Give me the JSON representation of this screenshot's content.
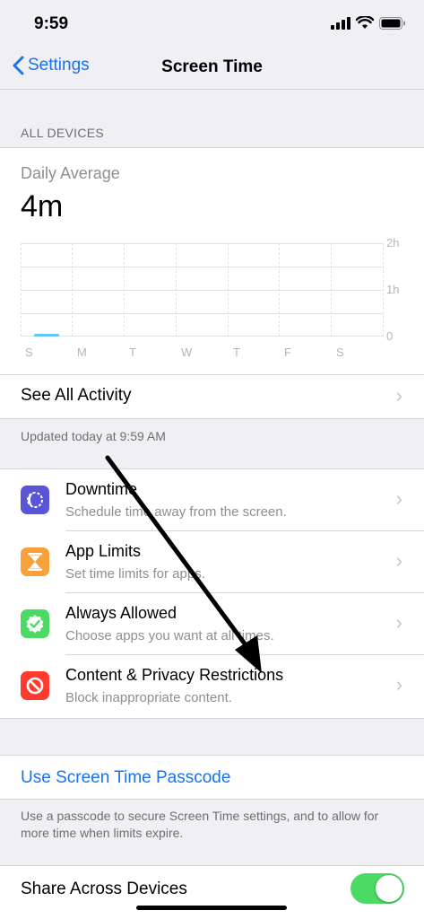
{
  "status_bar": {
    "time": "9:59"
  },
  "nav": {
    "back_label": "Settings",
    "title": "Screen Time"
  },
  "all_devices_header": "ALL DEVICES",
  "summary": {
    "daily_average_label": "Daily Average",
    "daily_average_value": "4m"
  },
  "chart": {
    "y_labels": [
      "2h",
      "1h",
      "0"
    ],
    "x_labels": [
      "S",
      "M",
      "T",
      "W",
      "T",
      "F",
      "S"
    ]
  },
  "chart_data": {
    "type": "bar",
    "categories": [
      "S",
      "M",
      "T",
      "W",
      "T",
      "F",
      "S"
    ],
    "values": [
      4,
      0,
      0,
      0,
      0,
      0,
      0
    ],
    "unit": "minutes",
    "ylim": [
      0,
      120
    ],
    "ytick_labels": [
      "0",
      "1h",
      "2h"
    ],
    "grid": true,
    "bar_color": "#5ac8fa"
  },
  "see_all_label": "See All Activity",
  "updated_text": "Updated today at 9:59 AM",
  "features": [
    {
      "title": "Downtime",
      "subtitle": "Schedule time away from the screen.",
      "icon": "downtime-icon",
      "color": "#5856d6"
    },
    {
      "title": "App Limits",
      "subtitle": "Set time limits for apps.",
      "icon": "hourglass-icon",
      "color": "#f7a13a"
    },
    {
      "title": "Always Allowed",
      "subtitle": "Choose apps you want at all times.",
      "icon": "checkmark-badge-icon",
      "color": "#4cd964"
    },
    {
      "title": "Content & Privacy Restrictions",
      "subtitle": "Block inappropriate content.",
      "icon": "no-entry-icon",
      "color": "#ff3b30"
    }
  ],
  "passcode_label": "Use Screen Time Passcode",
  "passcode_footnote": "Use a passcode to secure Screen Time settings, and to allow for more time when limits expire.",
  "share": {
    "label": "Share Across Devices",
    "enabled": true
  },
  "colors": {
    "accent": "#1a73e8",
    "toggle_on": "#4cd964"
  }
}
